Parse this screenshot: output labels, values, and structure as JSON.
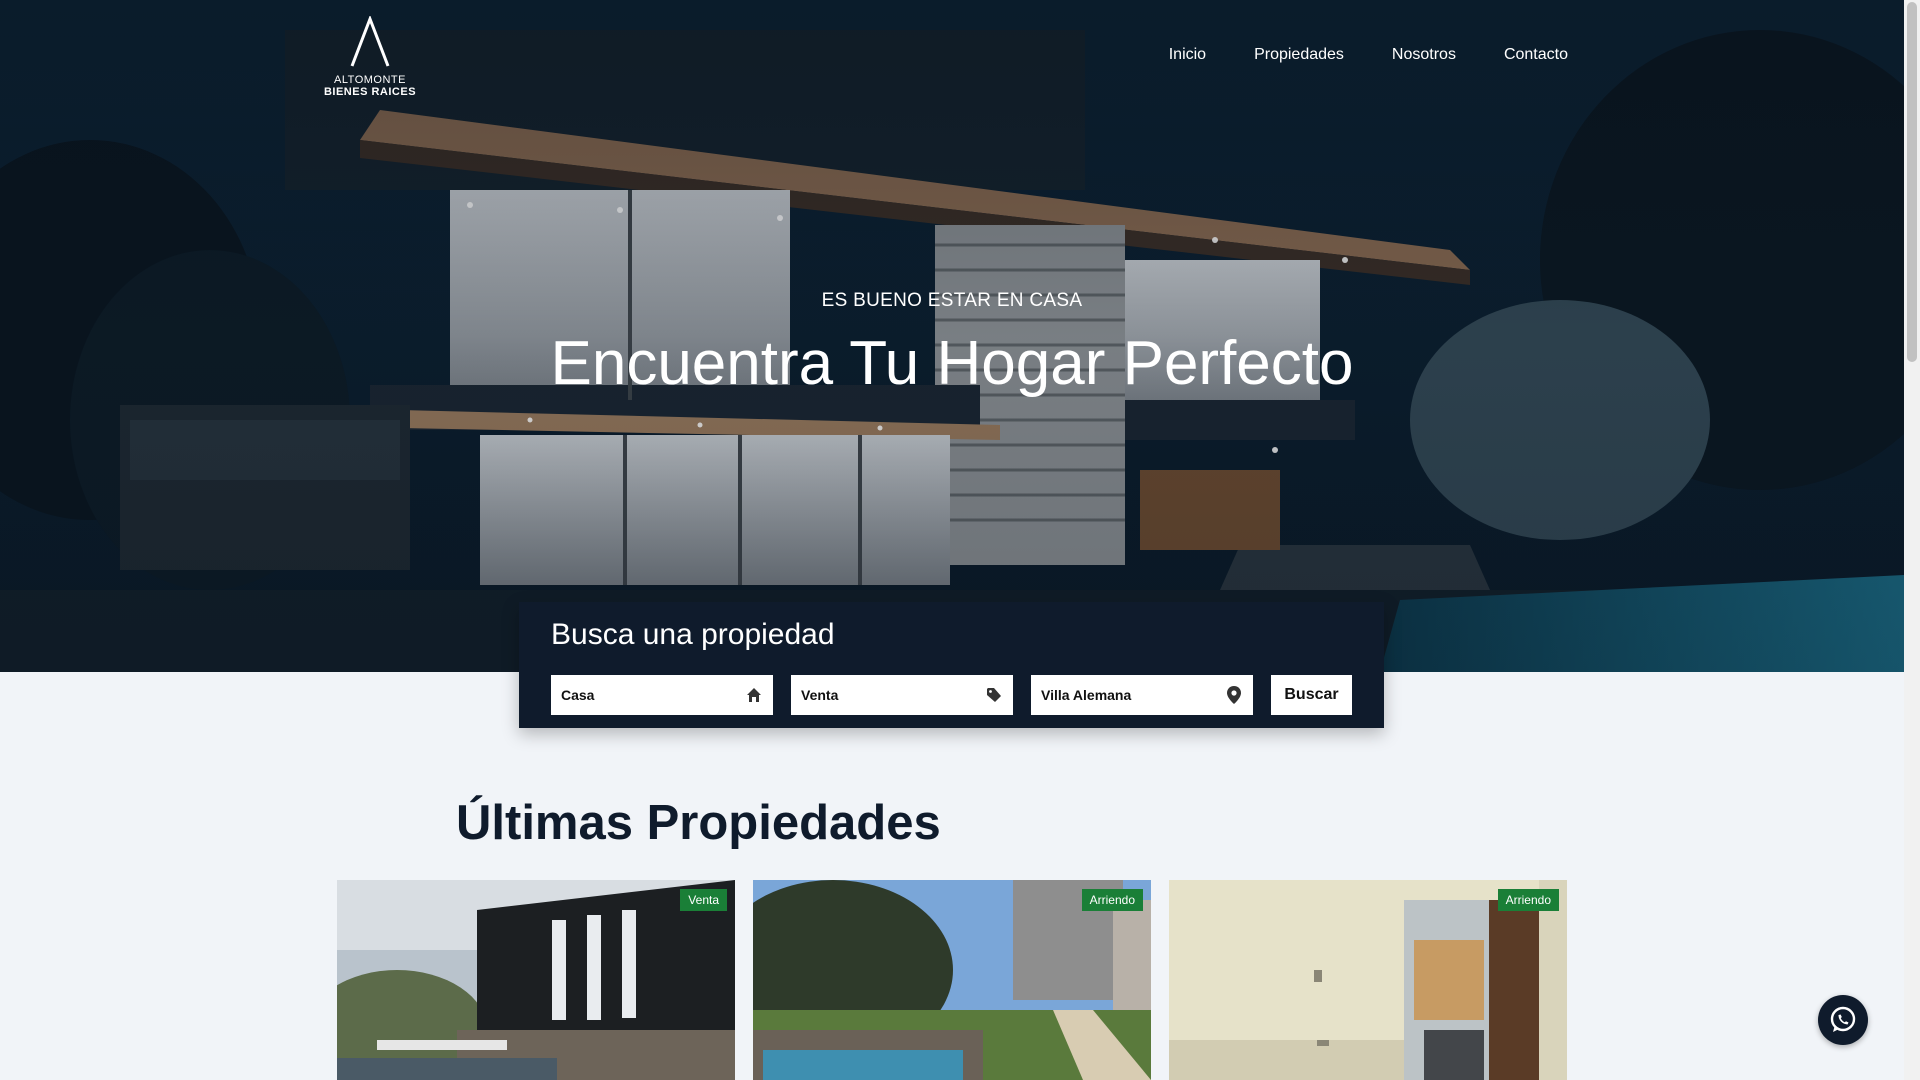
{
  "brand": {
    "line1": "ALTOMONTE",
    "line2": "BIENES RAICES"
  },
  "nav": [
    {
      "label": "Inicio"
    },
    {
      "label": "Propiedades"
    },
    {
      "label": "Nosotros"
    },
    {
      "label": "Contacto"
    }
  ],
  "hero": {
    "eyebrow": "ES BUENO ESTAR EN CASA",
    "title": "Encuentra Tu Hogar Perfecto"
  },
  "search": {
    "title": "Busca una propiedad",
    "type": {
      "value": "Casa",
      "icon": "home-icon"
    },
    "operation": {
      "value": "Venta",
      "icon": "tag-icon"
    },
    "location": {
      "value": "Villa Alemana",
      "icon": "map-pin-icon"
    },
    "button": "Buscar"
  },
  "listings": {
    "title": "Últimas Propiedades",
    "cards": [
      {
        "badge": "Venta"
      },
      {
        "badge": "Arriendo"
      },
      {
        "badge": "Arriendo"
      }
    ]
  },
  "colors": {
    "navy": "#0f1b2c",
    "badge_green": "#1a7f37",
    "page_bg": "#f1f4f8"
  }
}
